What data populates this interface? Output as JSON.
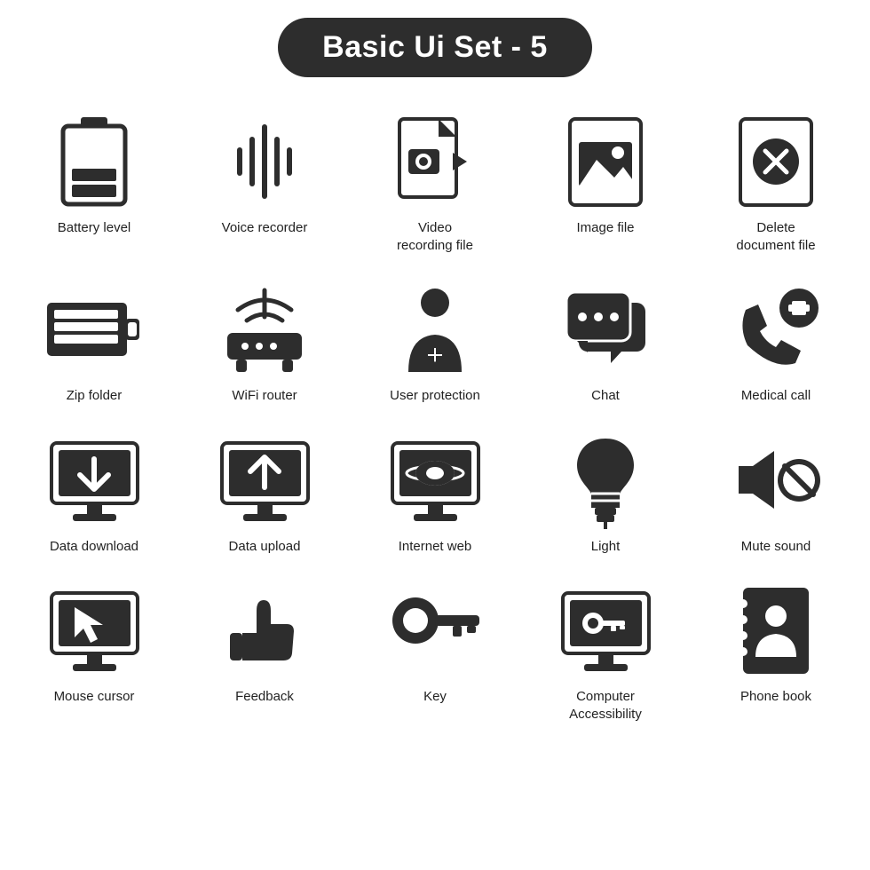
{
  "title": "Basic Ui Set - 5",
  "icons": [
    {
      "id": "battery-level",
      "label": "Battery level"
    },
    {
      "id": "voice-recorder",
      "label": "Voice recorder"
    },
    {
      "id": "video-recording-file",
      "label": "Video\nrecording file"
    },
    {
      "id": "image-file",
      "label": "Image file"
    },
    {
      "id": "delete-document-file",
      "label": "Delete\ndocument file"
    },
    {
      "id": "zip-folder",
      "label": "Zip folder"
    },
    {
      "id": "wifi-router",
      "label": "WiFi router"
    },
    {
      "id": "user-protection",
      "label": "User protection"
    },
    {
      "id": "chat",
      "label": "Chat"
    },
    {
      "id": "medical-call",
      "label": "Medical call"
    },
    {
      "id": "data-download",
      "label": "Data download"
    },
    {
      "id": "data-upload",
      "label": "Data upload"
    },
    {
      "id": "internet-web",
      "label": "Internet web"
    },
    {
      "id": "light",
      "label": "Light"
    },
    {
      "id": "mute-sound",
      "label": "Mute sound"
    },
    {
      "id": "mouse-cursor",
      "label": "Mouse cursor"
    },
    {
      "id": "feedback",
      "label": "Feedback"
    },
    {
      "id": "key",
      "label": "Key"
    },
    {
      "id": "computer-accessibility",
      "label": "Computer\nAccessibility"
    },
    {
      "id": "phone-book",
      "label": "Phone book"
    }
  ]
}
